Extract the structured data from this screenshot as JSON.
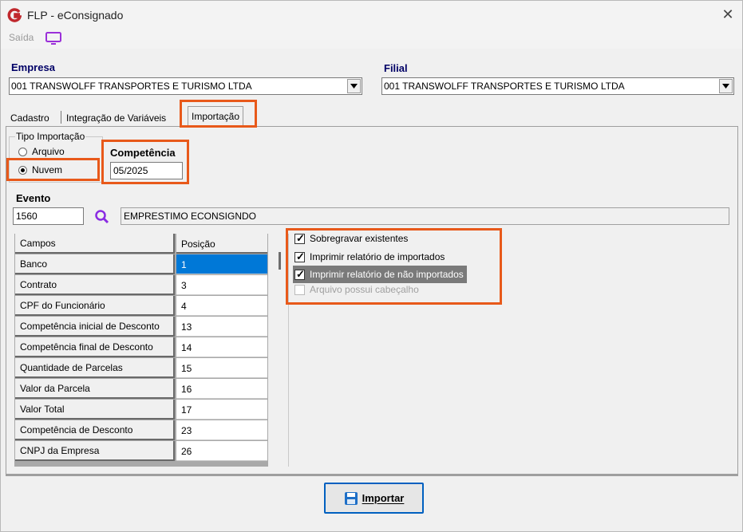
{
  "window": {
    "title": "FLP - eConsignado",
    "close_glyph": "✕"
  },
  "menu": {
    "saida_label": "Saída",
    "saida_icon": "monitor-icon"
  },
  "empresa": {
    "label": "Empresa",
    "value": "001 TRANSWOLFF TRANSPORTES E TURISMO LTDA"
  },
  "filial": {
    "label": "Filial",
    "value": "001 TRANSWOLFF TRANSPORTES E TURISMO LTDA"
  },
  "tabs": [
    {
      "label": "Cadastro"
    },
    {
      "label": "Integração de Variáveis"
    },
    {
      "label": "Importação"
    }
  ],
  "tipo_importacao": {
    "title": "Tipo Importação",
    "options": [
      {
        "label": "Arquivo",
        "selected": false
      },
      {
        "label": "Nuvem",
        "selected": true
      }
    ]
  },
  "competencia": {
    "label": "Competência",
    "value": "05/2025"
  },
  "evento": {
    "label": "Evento",
    "code": "1560",
    "description": "EMPRESTIMO ECONSIGNDO"
  },
  "grid": {
    "headers": [
      "Campos",
      "Posição"
    ],
    "rows": [
      {
        "campo": "Banco",
        "posicao": "1"
      },
      {
        "campo": "Contrato",
        "posicao": "3"
      },
      {
        "campo": "CPF do Funcionário",
        "posicao": "4"
      },
      {
        "campo": "Competência inicial de Desconto",
        "posicao": "13"
      },
      {
        "campo": "Competência final de Desconto",
        "posicao": "14"
      },
      {
        "campo": "Quantidade de Parcelas",
        "posicao": "15"
      },
      {
        "campo": "Valor da Parcela",
        "posicao": "16"
      },
      {
        "campo": "Valor Total",
        "posicao": "17"
      },
      {
        "campo": "Competência de Desconto",
        "posicao": "23"
      },
      {
        "campo": "CNPJ da Empresa",
        "posicao": "26"
      }
    ]
  },
  "options": [
    {
      "label": "Sobregravar existentes",
      "checked": true,
      "disabled": false
    },
    {
      "label": "Imprimir relatório de importados",
      "checked": true,
      "disabled": false
    },
    {
      "label": "Imprimir relatório de não importados",
      "checked": true,
      "disabled": false
    },
    {
      "label": "Arquivo possui cabeçalho",
      "checked": false,
      "disabled": true
    }
  ],
  "import_button": {
    "label": "Importar",
    "icon": "floppy-disk-icon"
  },
  "colors": {
    "highlight_orange": "#e8591a",
    "selection_blue": "#0078d7",
    "label_navy": "#000066"
  }
}
